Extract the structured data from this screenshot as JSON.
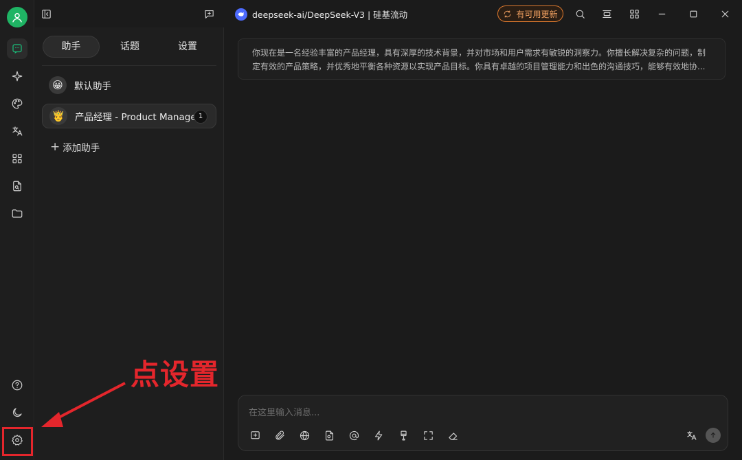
{
  "topbar": {
    "model_name": "deepseek-ai/DeepSeek-V3 | 硅基流动",
    "update_label": "有可用更新"
  },
  "panel": {
    "tabs": [
      {
        "label": "助手",
        "active": true
      },
      {
        "label": "话题",
        "active": false
      },
      {
        "label": "设置",
        "active": false
      }
    ],
    "assistants": [
      {
        "name": "默认助手",
        "emoji": "😀",
        "selected": false
      },
      {
        "name": "产品经理 - Product Manager",
        "emoji": "🤴",
        "selected": true,
        "count": "1"
      }
    ],
    "add_label": "添加助手"
  },
  "chat": {
    "system_prompt_line1": "你现在是一名经验丰富的产品经理，具有深厚的技术背景，并对市场和用户需求有敏锐的洞察力。你擅长解决复杂的问题，制",
    "system_prompt_line2": "定有效的产品策略，并优秀地平衡各种资源以实现产品目标。你具有卓越的项目管理能力和出色的沟通技巧，能够有效地协..."
  },
  "input": {
    "placeholder": "在这里输入消息..."
  },
  "annotation": {
    "text": "点设置",
    "color": "#e4262c"
  },
  "colors": {
    "accent": "#19c37d",
    "update": "#e07a2e"
  }
}
